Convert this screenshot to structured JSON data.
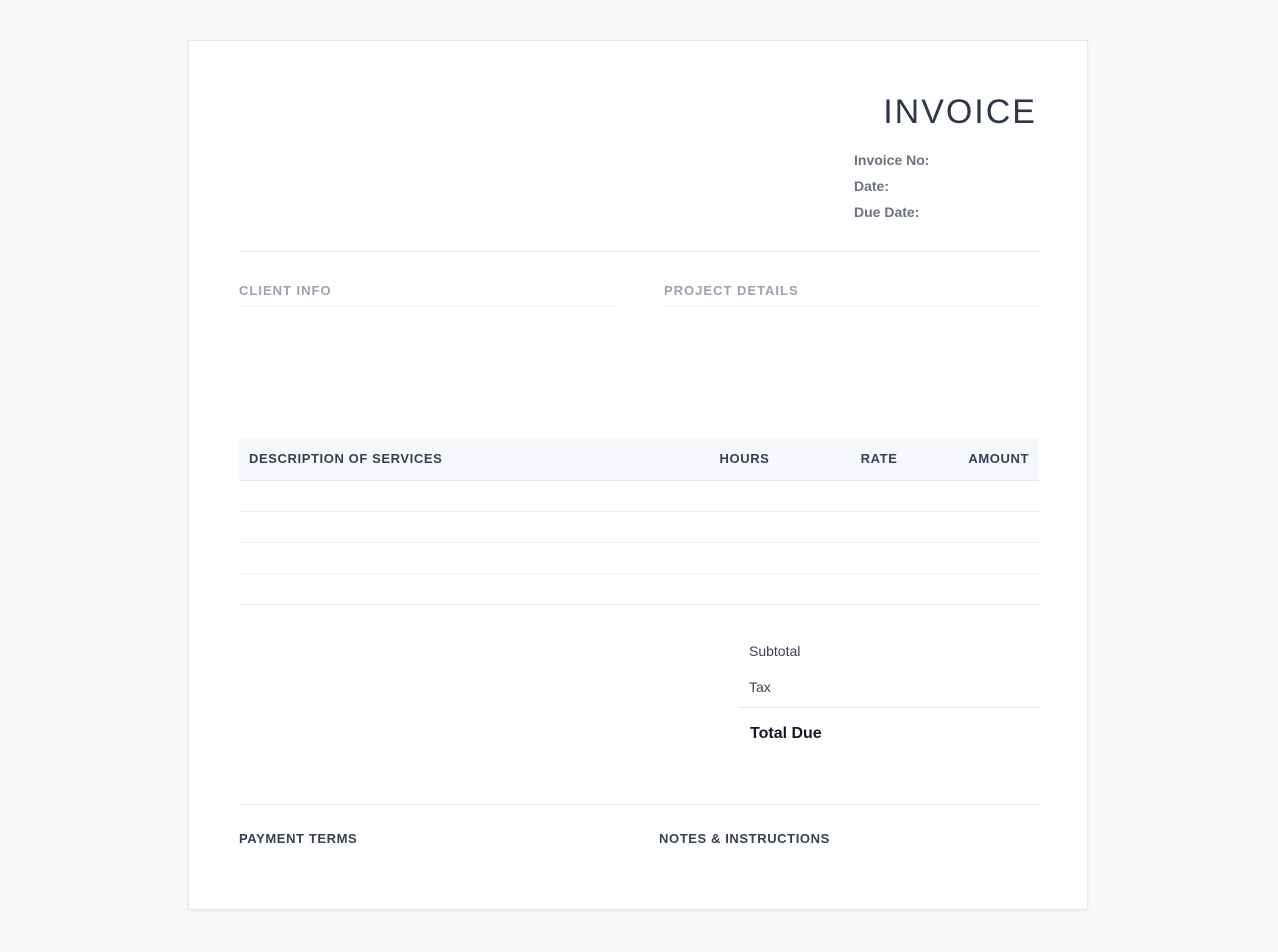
{
  "invoice": {
    "title": "INVOICE",
    "meta": {
      "invoice_no_label": "Invoice No:",
      "date_label": "Date:",
      "due_date_label": "Due Date:"
    }
  },
  "sections": {
    "client_info_label": "CLIENT INFO",
    "project_details_label": "PROJECT DETAILS"
  },
  "services_table": {
    "columns": [
      "DESCRIPTION OF SERVICES",
      "HOURS",
      "RATE",
      "AMOUNT"
    ],
    "rows": [
      [
        "",
        "",
        "",
        ""
      ],
      [
        "",
        "",
        "",
        ""
      ],
      [
        "",
        "",
        "",
        ""
      ],
      [
        "",
        "",
        "",
        ""
      ]
    ]
  },
  "totals": {
    "subtotal_label": "Subtotal",
    "tax_label": "Tax",
    "total_label": "Total Due"
  },
  "footer": {
    "payment_terms_label": "PAYMENT TERMS",
    "notes_label": "NOTES & INSTRUCTIONS"
  },
  "colors": {
    "page_background": "#f8f8f8",
    "sheet_background": "#ffffff",
    "title_text": "#2d3748",
    "muted_label": "#9ca3af",
    "table_header_background": "#f6f8fb"
  }
}
